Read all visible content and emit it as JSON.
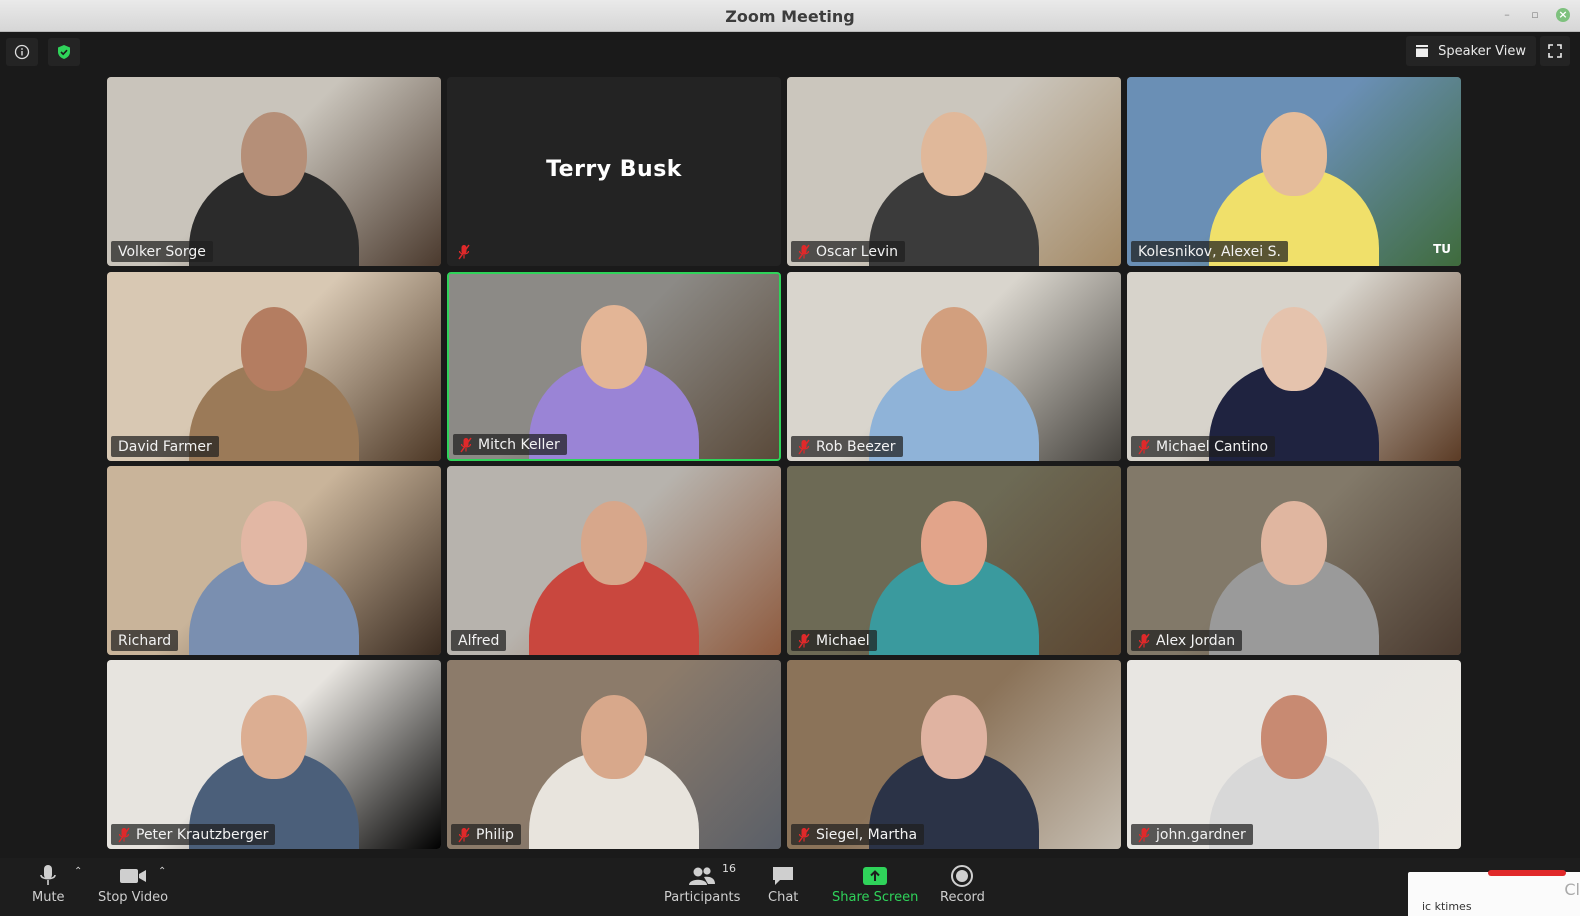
{
  "window": {
    "title": "Zoom Meeting"
  },
  "header": {
    "view_label": "Speaker View"
  },
  "participants": [
    {
      "name": "Volker Sorge",
      "muted": false,
      "video": true
    },
    {
      "name": "Terry Busk",
      "muted": true,
      "video": false
    },
    {
      "name": "Oscar Levin",
      "muted": true,
      "video": true
    },
    {
      "name": "Kolesnikov, Alexei S.",
      "muted": false,
      "video": true,
      "corner_logo": "TU"
    },
    {
      "name": "David Farmer",
      "muted": false,
      "video": true
    },
    {
      "name": "Mitch Keller",
      "muted": true,
      "video": true,
      "active_speaker": true
    },
    {
      "name": "Rob Beezer",
      "muted": true,
      "video": true
    },
    {
      "name": "Michael Cantino",
      "muted": true,
      "video": true
    },
    {
      "name": "Richard",
      "muted": false,
      "video": true
    },
    {
      "name": "Alfred",
      "muted": false,
      "video": true
    },
    {
      "name": "Michael",
      "muted": true,
      "video": true
    },
    {
      "name": "Alex Jordan",
      "muted": true,
      "video": true
    },
    {
      "name": "Peter Krautzberger",
      "muted": true,
      "video": true
    },
    {
      "name": "Philip",
      "muted": true,
      "video": true
    },
    {
      "name": "Siegel, Martha",
      "muted": true,
      "video": true
    },
    {
      "name": "john.gardner",
      "muted": true,
      "video": true
    }
  ],
  "toolbar": {
    "mute_label": "Mute",
    "stop_video_label": "Stop Video",
    "participants_label": "Participants",
    "participants_count": "16",
    "chat_label": "Chat",
    "share_screen_label": "Share Screen",
    "record_label": "Record"
  },
  "notification": {
    "text_partial": "ic ktimes",
    "close_partial": "Cl"
  },
  "colors": {
    "active_speaker_border": "#2fd35a",
    "share_screen": "#2fd35a",
    "muted_mic": "#e0292a",
    "background": "#1a1a1a"
  }
}
